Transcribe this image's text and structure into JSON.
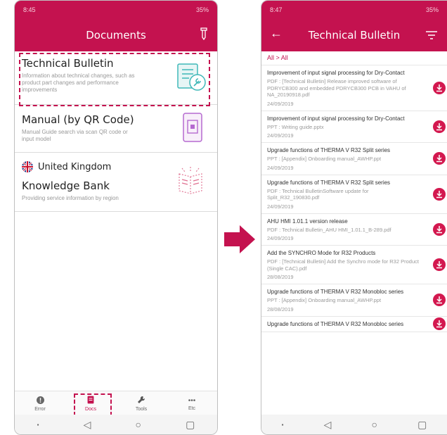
{
  "left_phone": {
    "status_time": "8:45",
    "status_right": "35%",
    "title": "Documents",
    "items": [
      {
        "title": "Technical Bulletin",
        "desc": "Information about technical changes, such as product part changes and performance improvements"
      },
      {
        "title": "Manual (by QR Code)",
        "desc": "Manual Guide search via scan QR code or input model"
      },
      {
        "region": "United Kingdom",
        "title": "Knowledge Bank",
        "desc": "Providing service information by region"
      }
    ],
    "nav": [
      {
        "label": "Error"
      },
      {
        "label": "Docs"
      },
      {
        "label": "Tools"
      },
      {
        "label": "Etc"
      }
    ]
  },
  "right_phone": {
    "status_time": "8:47",
    "status_right": "35%",
    "title": "Technical Bulletin",
    "breadcrumb": "All > All",
    "rows": [
      {
        "title": "Improvement of input signal processing for Dry-Contact",
        "file": "PDF : [Technical Bulletin] Release improved software of PDRYCB300 and embedded PDRYCB300 PCB in VAHU of NA_20190918.pdf",
        "date": "24/09/2019"
      },
      {
        "title": "Improvement of input signal processing for Dry-Contact",
        "file": "PPT : Writing guide.pptx",
        "date": "24/09/2019"
      },
      {
        "title": "Upgrade functions of THERMA V R32 Split series",
        "file": "PPT : [Appendix] Onboarding manual_AWHP.ppt",
        "date": "24/09/2019"
      },
      {
        "title": "Upgrade functions of THERMA V R32 Split series",
        "file": "PDF : Technical BulletinSoftware update for Split_R32_190830.pdf",
        "date": "24/09/2019"
      },
      {
        "title": "AHU HMI 1.01.1 version release",
        "file": "PDF : Technical Bulletin_AHU HMI_1.01.1_B-289.pdf",
        "date": "24/09/2019"
      },
      {
        "title": "Add the SYNCHRO Mode for R32 Products",
        "file": "PDF : [Technical Bulletin] Add the Synchro mode for R32 Product (Single CAC).pdf",
        "date": "28/08/2019"
      },
      {
        "title": "Upgrade functions of THERMA V R32 Monobloc series",
        "file": "PPT : [Appendix] Onboarding manual_AWHP.ppt",
        "date": "28/08/2019"
      },
      {
        "title": "Upgrade functions of THERMA V R32 Monobloc series",
        "file": "",
        "date": ""
      }
    ]
  },
  "colors": {
    "brand": "#c4124f",
    "muted": "#9a9a9a"
  },
  "icons": [
    "signal-icon",
    "battery-icon",
    "back-arrow-icon",
    "menu-icon",
    "filter-icon",
    "download-icon",
    "bulletin-icon",
    "qr-code-icon",
    "book-icon",
    "flag-icon",
    "error-icon",
    "docs-icon",
    "tools-icon",
    "more-icon"
  ]
}
